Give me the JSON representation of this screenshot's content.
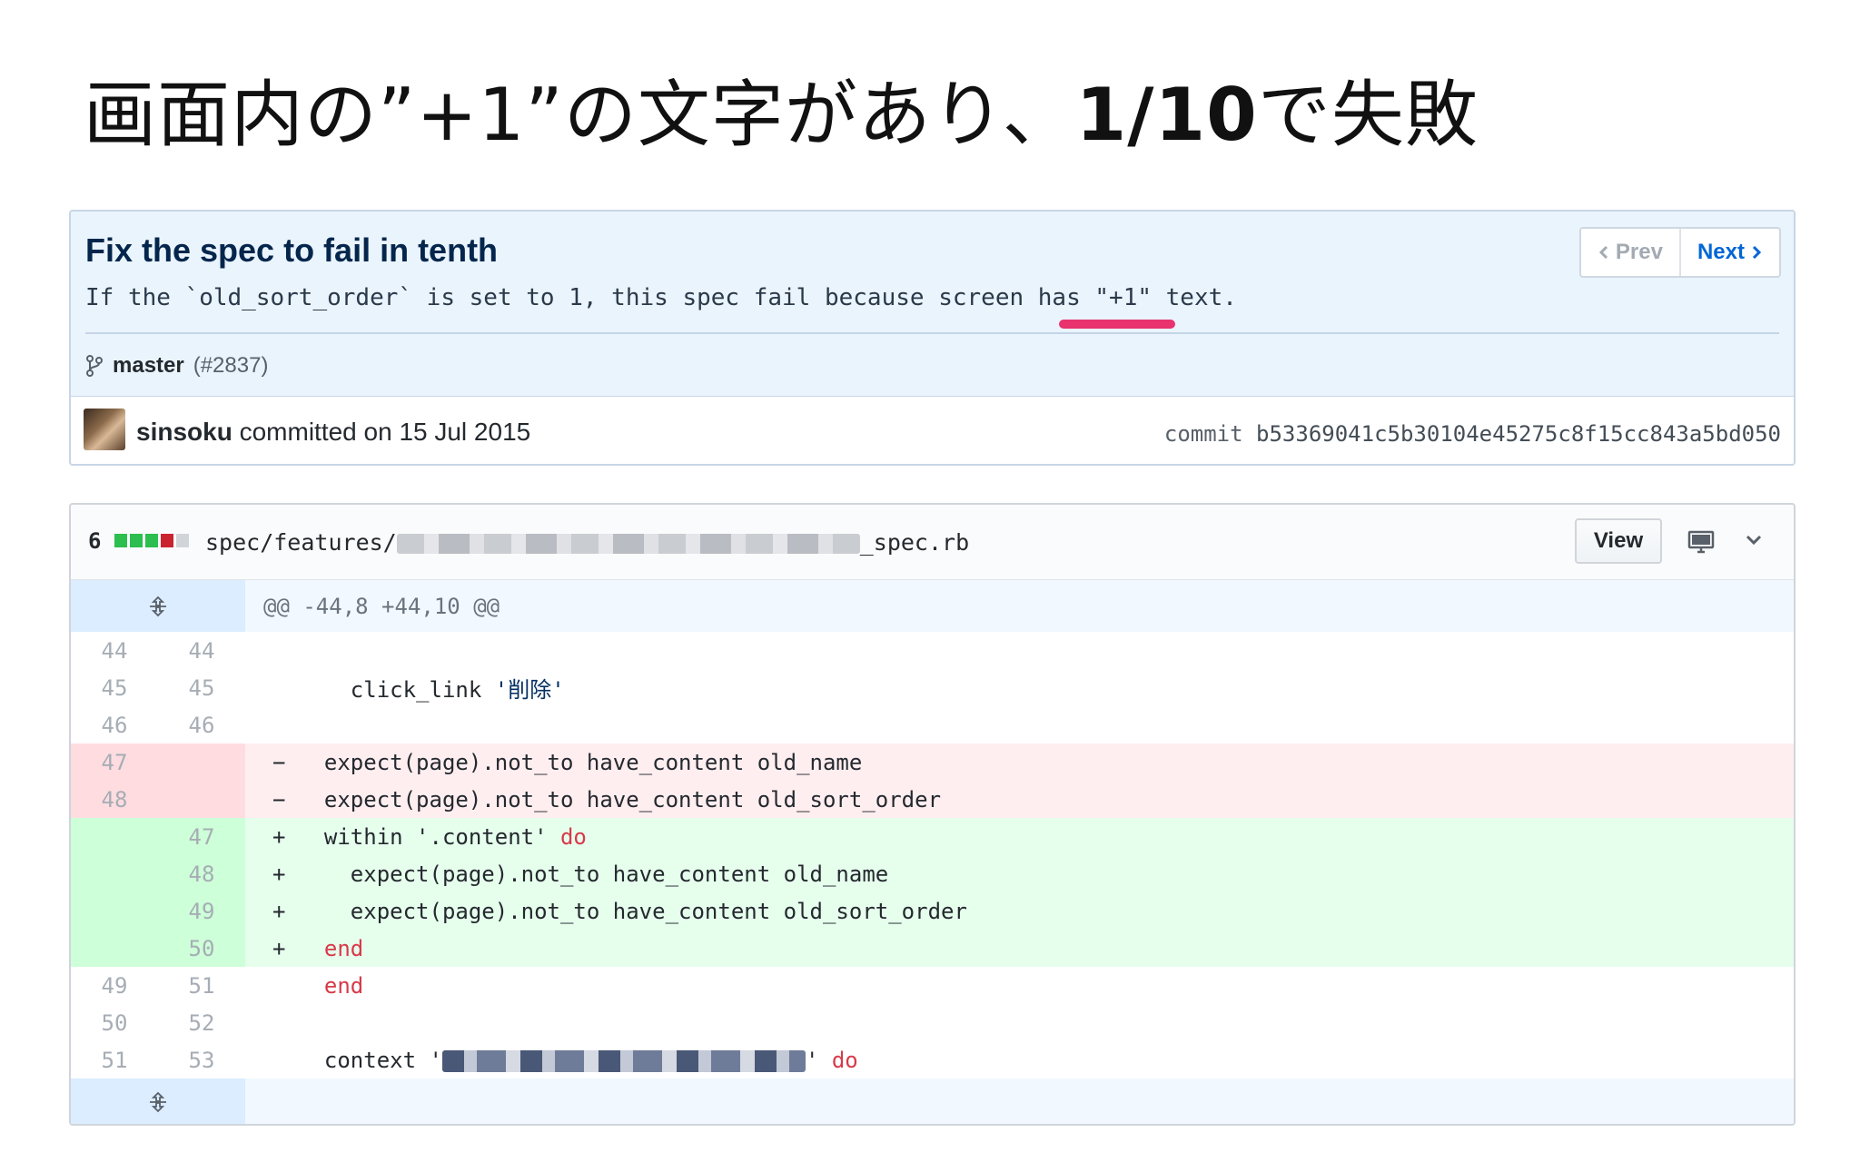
{
  "slide": {
    "title_prefix": "画面内の”+1”の文字があり、",
    "title_bold": "1/10",
    "title_suffix": "で失敗"
  },
  "commit": {
    "title": "Fix the spec to fail in tenth",
    "description": "If the `old_sort_order` is set to 1, this spec fail because screen has \"+1\" text.",
    "branch": "master",
    "pr_ref": "(#2837)",
    "author": "sinsoku",
    "committed_text": " committed on 15 Jul 2015",
    "commit_label": "commit",
    "sha": "b53369041c5b30104e45275c8f15cc843a5bd050",
    "prev_label": "Prev",
    "next_label": "Next"
  },
  "file": {
    "changes": "6",
    "path_prefix": "spec/features/",
    "path_suffix": "_spec.rb",
    "view_label": "View",
    "diffstat_colors": [
      "#2cbe4e",
      "#2cbe4e",
      "#2cbe4e",
      "#cb2431",
      "#d1d5da"
    ]
  },
  "diff": {
    "hunk_header": "@@ -44,8 +44,10 @@",
    "lines": [
      {
        "type": "ctx",
        "old": "44",
        "new": "44",
        "sign": "",
        "parts": [
          {
            "t": ""
          }
        ]
      },
      {
        "type": "ctx",
        "old": "45",
        "new": "45",
        "sign": "",
        "parts": [
          {
            "t": "    click_link "
          },
          {
            "t": "'削除'",
            "c": "str"
          }
        ]
      },
      {
        "type": "ctx",
        "old": "46",
        "new": "46",
        "sign": "",
        "parts": [
          {
            "t": ""
          }
        ]
      },
      {
        "type": "del",
        "old": "47",
        "new": "",
        "sign": "−",
        "parts": [
          {
            "t": "  expect(page).not_to have_content old_name"
          }
        ]
      },
      {
        "type": "del",
        "old": "48",
        "new": "",
        "sign": "−",
        "parts": [
          {
            "t": "  expect(page).not_to have_content old_sort_order"
          }
        ]
      },
      {
        "type": "add",
        "old": "",
        "new": "47",
        "sign": "+",
        "parts": [
          {
            "t": "  within '.content' "
          },
          {
            "t": "do",
            "c": "kw"
          }
        ]
      },
      {
        "type": "add",
        "old": "",
        "new": "48",
        "sign": "+",
        "parts": [
          {
            "t": "    expect(page).not_to have_content old_name"
          }
        ]
      },
      {
        "type": "add",
        "old": "",
        "new": "49",
        "sign": "+",
        "parts": [
          {
            "t": "    expect(page).not_to have_content old_sort_order"
          }
        ]
      },
      {
        "type": "add",
        "old": "",
        "new": "50",
        "sign": "+",
        "parts": [
          {
            "t": "  "
          },
          {
            "t": "end",
            "c": "kw"
          }
        ]
      },
      {
        "type": "ctx",
        "old": "49",
        "new": "51",
        "sign": "",
        "parts": [
          {
            "t": "  "
          },
          {
            "t": "end",
            "c": "kw"
          }
        ]
      },
      {
        "type": "ctx",
        "old": "50",
        "new": "52",
        "sign": "",
        "parts": [
          {
            "t": ""
          }
        ]
      },
      {
        "type": "ctx",
        "old": "51",
        "new": "53",
        "sign": "",
        "parts": [
          {
            "t": "  context '"
          },
          {
            "blur": true
          },
          {
            "t": "' "
          },
          {
            "t": "do",
            "c": "kw"
          }
        ]
      }
    ]
  }
}
